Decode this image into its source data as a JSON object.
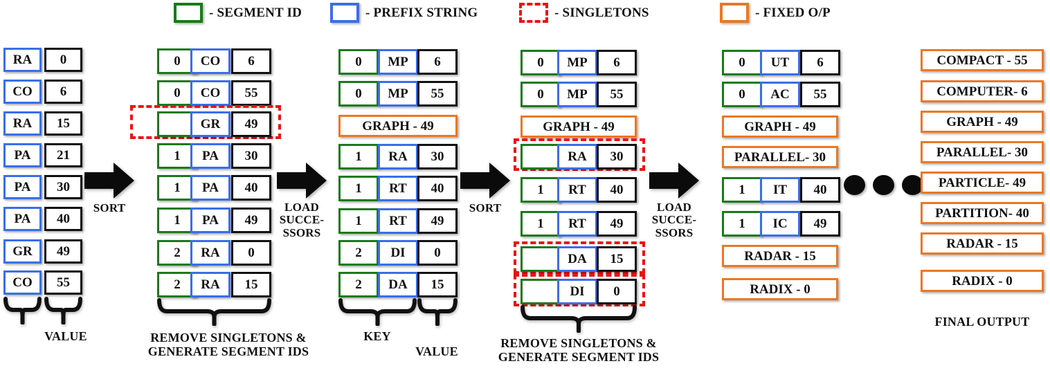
{
  "legend": [
    {
      "swatch": "green",
      "label": "- SEGMENT ID"
    },
    {
      "swatch": "blue",
      "label": "- PREFIX STRING"
    },
    {
      "swatch": "red",
      "label": "- SINGLETONS"
    },
    {
      "swatch": "orange",
      "label": "- FIXED O/P"
    }
  ],
  "col1": {
    "rows": [
      {
        "prefix": "RA",
        "value": "0"
      },
      {
        "prefix": "CO",
        "value": "6"
      },
      {
        "prefix": "RA",
        "value": "15"
      },
      {
        "prefix": "PA",
        "value": "21"
      },
      {
        "prefix": "PA",
        "value": "30"
      },
      {
        "prefix": "PA",
        "value": "40"
      },
      {
        "prefix": "GR",
        "value": "49"
      },
      {
        "prefix": "CO",
        "value": "55"
      }
    ],
    "brace_label_value": "VALUE"
  },
  "col2": {
    "rows": [
      {
        "seg": "0",
        "prefix": "CO",
        "value": "6",
        "singleton": false
      },
      {
        "seg": "0",
        "prefix": "CO",
        "value": "55",
        "singleton": false
      },
      {
        "seg": "",
        "prefix": "GR",
        "value": "49",
        "singleton": true
      },
      {
        "seg": "1",
        "prefix": "PA",
        "value": "30",
        "singleton": false
      },
      {
        "seg": "1",
        "prefix": "PA",
        "value": "40",
        "singleton": false
      },
      {
        "seg": "1",
        "prefix": "PA",
        "value": "49",
        "singleton": false
      },
      {
        "seg": "2",
        "prefix": "RA",
        "value": "0",
        "singleton": false
      },
      {
        "seg": "2",
        "prefix": "RA",
        "value": "15",
        "singleton": false
      }
    ],
    "caption": "REMOVE SINGLETONS &\nGENERATE SEGMENT IDS"
  },
  "col3": {
    "rows": [
      {
        "kind": "triple",
        "seg": "0",
        "prefix": "MP",
        "value": "6"
      },
      {
        "kind": "triple",
        "seg": "0",
        "prefix": "MP",
        "value": "55"
      },
      {
        "kind": "fixed",
        "text": "GRAPH - 49"
      },
      {
        "kind": "triple",
        "seg": "1",
        "prefix": "RA",
        "value": "30"
      },
      {
        "kind": "triple",
        "seg": "1",
        "prefix": "RT",
        "value": "40"
      },
      {
        "kind": "triple",
        "seg": "1",
        "prefix": "RT",
        "value": "49"
      },
      {
        "kind": "triple",
        "seg": "2",
        "prefix": "DI",
        "value": "0"
      },
      {
        "kind": "triple",
        "seg": "2",
        "prefix": "DA",
        "value": "15"
      }
    ],
    "brace_label_key": "KEY",
    "brace_label_value": "VALUE"
  },
  "col4": {
    "rows": [
      {
        "kind": "triple",
        "seg": "0",
        "prefix": "MP",
        "value": "6",
        "singleton": false
      },
      {
        "kind": "triple",
        "seg": "0",
        "prefix": "MP",
        "value": "55",
        "singleton": false
      },
      {
        "kind": "fixed",
        "text": "GRAPH - 49"
      },
      {
        "kind": "triple",
        "seg": "",
        "prefix": "RA",
        "value": "30",
        "singleton": true
      },
      {
        "kind": "triple",
        "seg": "1",
        "prefix": "RT",
        "value": "40",
        "singleton": false
      },
      {
        "kind": "triple",
        "seg": "1",
        "prefix": "RT",
        "value": "49",
        "singleton": false
      },
      {
        "kind": "triple",
        "seg": "",
        "prefix": "DA",
        "value": "15",
        "singleton": true
      },
      {
        "kind": "triple",
        "seg": "",
        "prefix": "DI",
        "value": "0",
        "singleton": true
      }
    ],
    "caption": "REMOVE SINGLETONS &\nGENERATE SEGMENT IDS"
  },
  "col5": {
    "rows": [
      {
        "kind": "triple",
        "seg": "0",
        "prefix": "UT",
        "value": "6"
      },
      {
        "kind": "triple",
        "seg": "0",
        "prefix": "AC",
        "value": "55"
      },
      {
        "kind": "fixed",
        "text": "GRAPH - 49"
      },
      {
        "kind": "fixed",
        "text": "PARALLEL- 30"
      },
      {
        "kind": "triple",
        "seg": "1",
        "prefix": "IT",
        "value": "40"
      },
      {
        "kind": "triple",
        "seg": "1",
        "prefix": "IC",
        "value": "49"
      },
      {
        "kind": "fixed",
        "text": "RADAR - 15"
      },
      {
        "kind": "fixed",
        "text": "RADIX - 0"
      }
    ]
  },
  "col6": {
    "rows": [
      "COMPACT - 55",
      "COMPUTER- 6",
      "GRAPH - 49",
      "PARALLEL- 30",
      "PARTICLE- 49",
      "PARTITION- 40",
      "RADAR - 15",
      "RADIX - 0"
    ],
    "caption": "FINAL OUTPUT"
  },
  "arrows": [
    {
      "label": "SORT"
    },
    {
      "label": "LOAD\nSUCCE-\nSSORS"
    },
    {
      "label": "SORT"
    },
    {
      "label": "LOAD\nSUCCE-\nSSORS"
    }
  ],
  "colors": {
    "segment_id": "#1a7a1a",
    "prefix_string": "#3a6ee8",
    "singletons": "#ee1111",
    "fixed_output": "#ea7825",
    "value_box": "#111111"
  }
}
